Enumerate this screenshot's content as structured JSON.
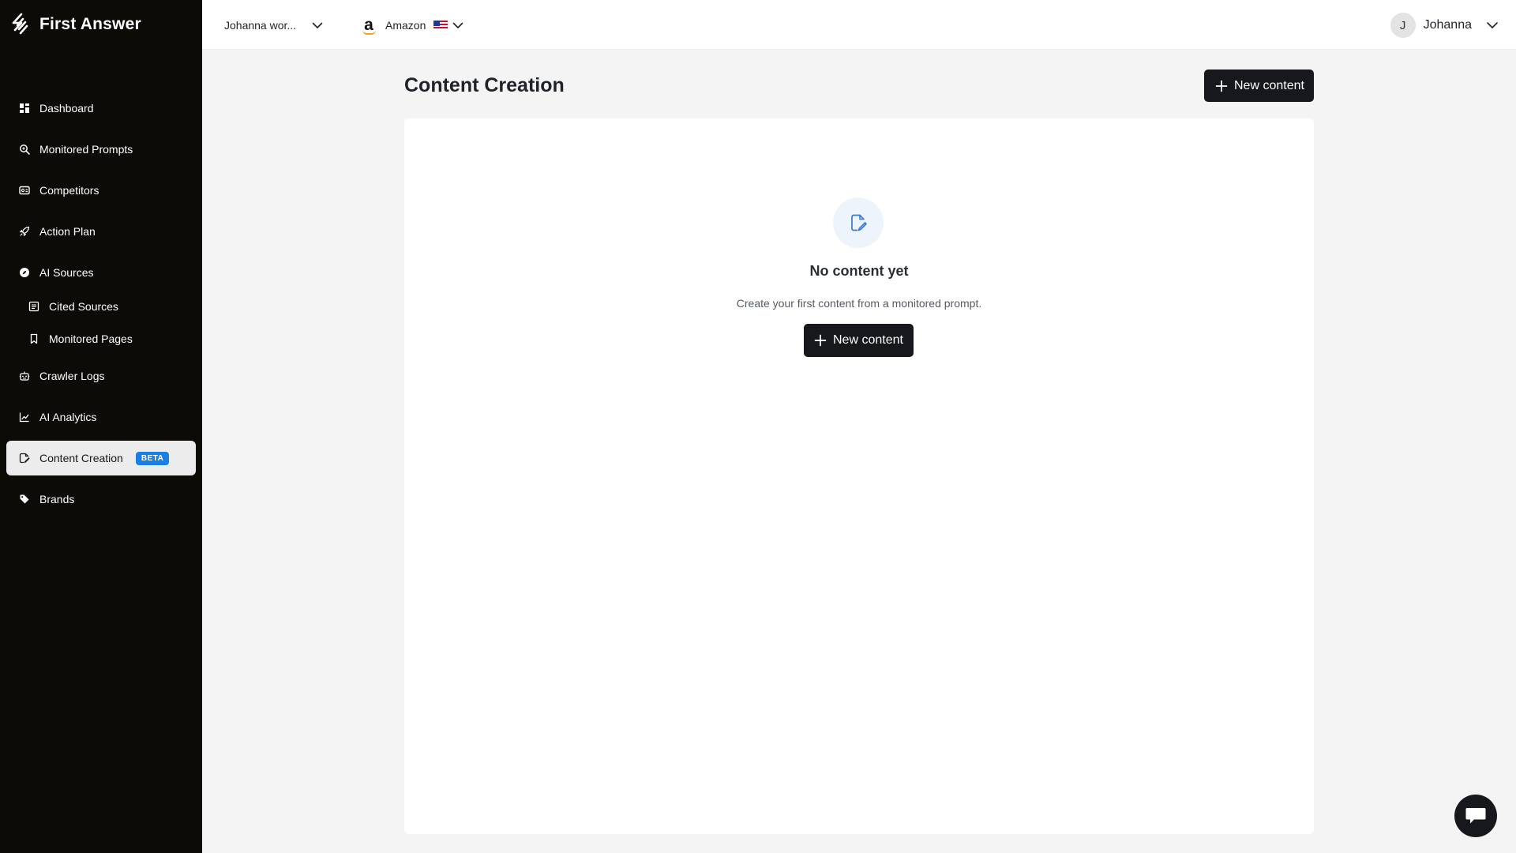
{
  "app": {
    "name": "First Answer"
  },
  "sidebar": {
    "items": [
      {
        "label": "Dashboard",
        "icon": "dashboard-icon"
      },
      {
        "label": "Monitored Prompts",
        "icon": "search-icon"
      },
      {
        "label": "Competitors",
        "icon": "competitors-icon"
      },
      {
        "label": "Action Plan",
        "icon": "rocket-icon"
      },
      {
        "label": "AI Sources",
        "icon": "compass-icon"
      },
      {
        "label": "Cited Sources",
        "icon": "list-icon"
      },
      {
        "label": "Monitored Pages",
        "icon": "bookmark-icon"
      },
      {
        "label": "Crawler Logs",
        "icon": "robot-icon"
      },
      {
        "label": "AI Analytics",
        "icon": "chart-icon"
      },
      {
        "label": "Content Creation",
        "icon": "edit-file-icon",
        "badge": "BETA",
        "active": true
      },
      {
        "label": "Brands",
        "icon": "tag-icon"
      }
    ]
  },
  "topbar": {
    "workspace": "Johanna wor...",
    "brand": "Amazon",
    "user_initial": "J",
    "user_name": "Johanna"
  },
  "main": {
    "title": "Content Creation",
    "new_content_label": "New content",
    "empty_title": "No content yet",
    "empty_subtitle": "Create your first content from a monitored prompt.",
    "empty_button_label": "New content"
  },
  "colors": {
    "sidebar_bg": "#0d0b06",
    "accent_dark": "#16181c",
    "beta_badge": "#1a7fe0",
    "page_bg": "#f4f4f4"
  }
}
